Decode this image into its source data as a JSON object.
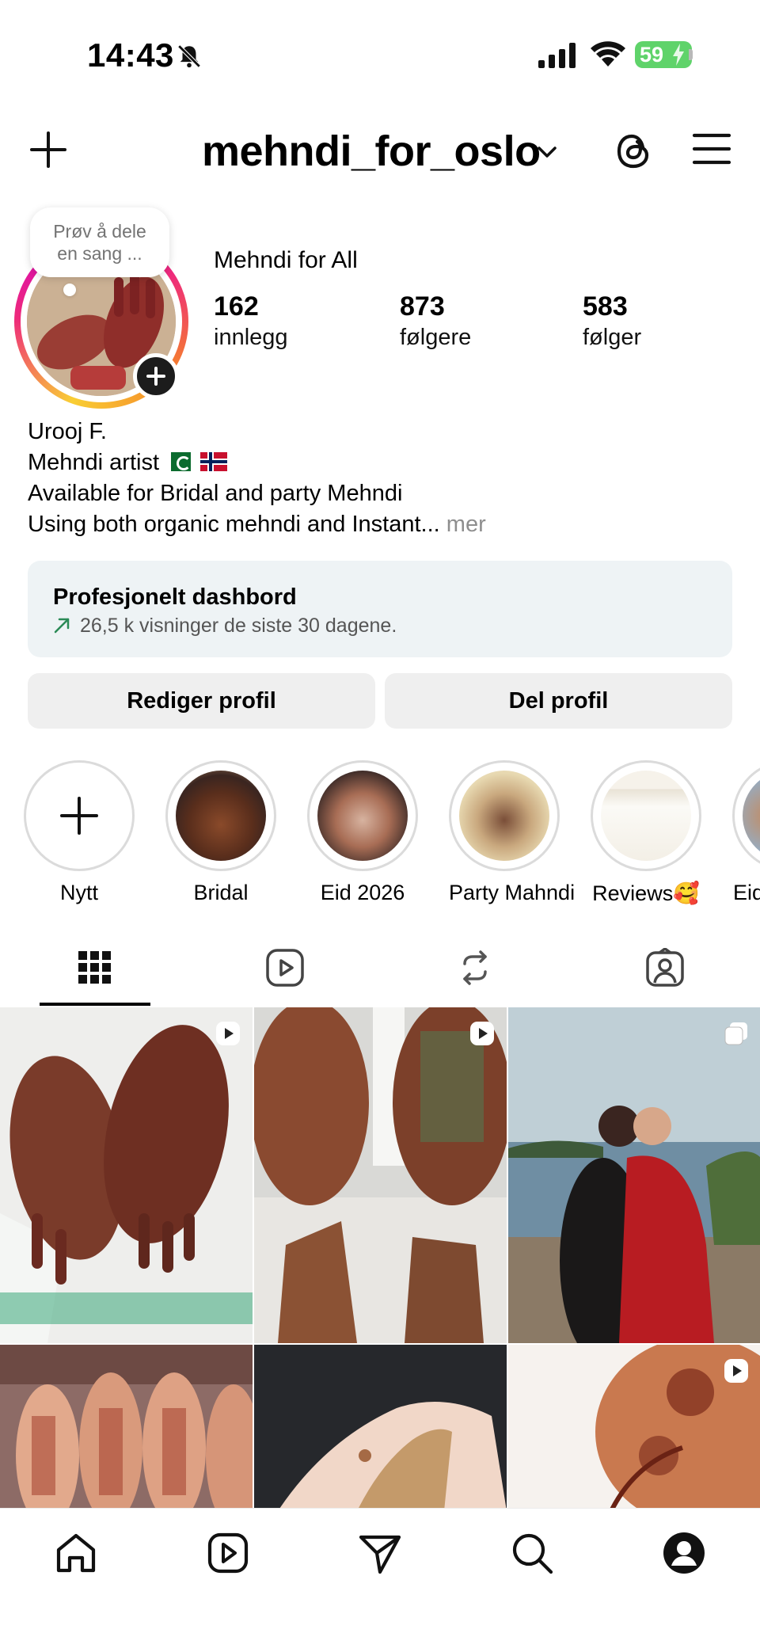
{
  "status_bar": {
    "time": "14:43",
    "battery": "59",
    "icons": [
      "bell-slash-icon",
      "signal-icon",
      "wifi-icon",
      "battery-icon"
    ]
  },
  "header": {
    "username": "mehndi_for_oslo",
    "icons": [
      "plus-icon",
      "chevron-down-icon",
      "threads-icon",
      "menu-icon"
    ]
  },
  "note": {
    "text_line1": "Prøv å dele",
    "text_line2": "en sang ..."
  },
  "profile": {
    "display_name": "Mehndi for All",
    "stats": [
      {
        "value": "162",
        "label": "innlegg"
      },
      {
        "value": "873",
        "label": "følgere"
      },
      {
        "value": "583",
        "label": "følger"
      }
    ],
    "bio": {
      "line1": "Urooj F.",
      "line2": "Mehndi artist",
      "line3": "Available for Bridal and party Mehndi",
      "line4": "Using both organic mehndi and Instant...",
      "more": "mer"
    }
  },
  "dashboard": {
    "title": "Profesjonelt dashbord",
    "subtitle": "26,5 k visninger de siste 30 dagene."
  },
  "buttons": {
    "edit": "Rediger profil",
    "share": "Del profil"
  },
  "highlights": [
    {
      "label": "Nytt"
    },
    {
      "label": "Bridal"
    },
    {
      "label": "Eid 2026"
    },
    {
      "label": "Party Mahndi"
    },
    {
      "label": "Reviews🥰"
    },
    {
      "label": "Eid"
    }
  ],
  "tabs": [
    "grid-icon",
    "reels-icon",
    "reposts-icon",
    "tagged-icon"
  ],
  "bottom_nav": [
    "home-icon",
    "reels-icon",
    "send-icon",
    "search-icon",
    "profile-icon"
  ]
}
